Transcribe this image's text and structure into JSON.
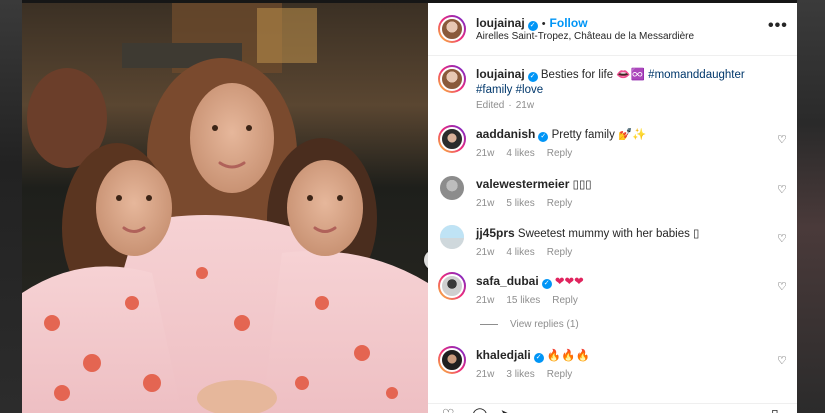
{
  "post": {
    "author": "loujainaj",
    "follow_label": "Follow",
    "location": "Airelles Saint-Tropez, Château de la Messardière",
    "more_label": "•••"
  },
  "caption": {
    "username": "loujainaj",
    "text": "Besties for life",
    "emoji": "👄♾️",
    "hashtags": "#momanddaughter #family",
    "hashtags2": "#love",
    "edited": "Edited",
    "age": "21w"
  },
  "comments": [
    {
      "username": "aaddanish",
      "verified": true,
      "text": "Pretty family 💅✨",
      "age": "21w",
      "likes": "4 likes",
      "reply": "Reply"
    },
    {
      "username": "valewestermeier",
      "verified": false,
      "text": "▯▯▯",
      "age": "21w",
      "likes": "5 likes",
      "reply": "Reply"
    },
    {
      "username": "jj45prs",
      "verified": false,
      "text": "Sweetest mummy with her babies ▯",
      "age": "21w",
      "likes": "4 likes",
      "reply": "Reply"
    },
    {
      "username": "safa_dubai",
      "verified": true,
      "text": "❤❤❤",
      "age": "21w",
      "likes": "15 likes",
      "reply": "Reply"
    },
    {
      "username": "khaledjali",
      "verified": true,
      "text": "🔥🔥🔥",
      "age": "21w",
      "likes": "3 likes",
      "reply": "Reply"
    }
  ],
  "view_replies": "View replies (1)",
  "icons": {
    "heart": "heart-icon",
    "comment": "comment-icon",
    "share": "share-icon",
    "save": "bookmark-icon",
    "next": "chevron-right-icon"
  },
  "colors": {
    "link_blue": "#0095f6",
    "hashtag": "#00376b",
    "meta_gray": "#8e8e8e"
  }
}
